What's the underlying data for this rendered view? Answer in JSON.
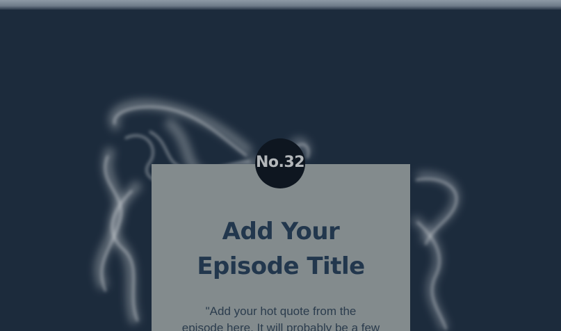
{
  "episode": {
    "number_label": "No.32",
    "title_line1": "Add Your",
    "title_line2": "Episode Title",
    "quote_line1": "\"Add your hot quote from the",
    "quote_line2": "episode here. It will probably be a few"
  },
  "colors": {
    "background": "#1c2b3c",
    "card": "#838b8d",
    "badge": "#0e1620",
    "title": "#22374d"
  }
}
